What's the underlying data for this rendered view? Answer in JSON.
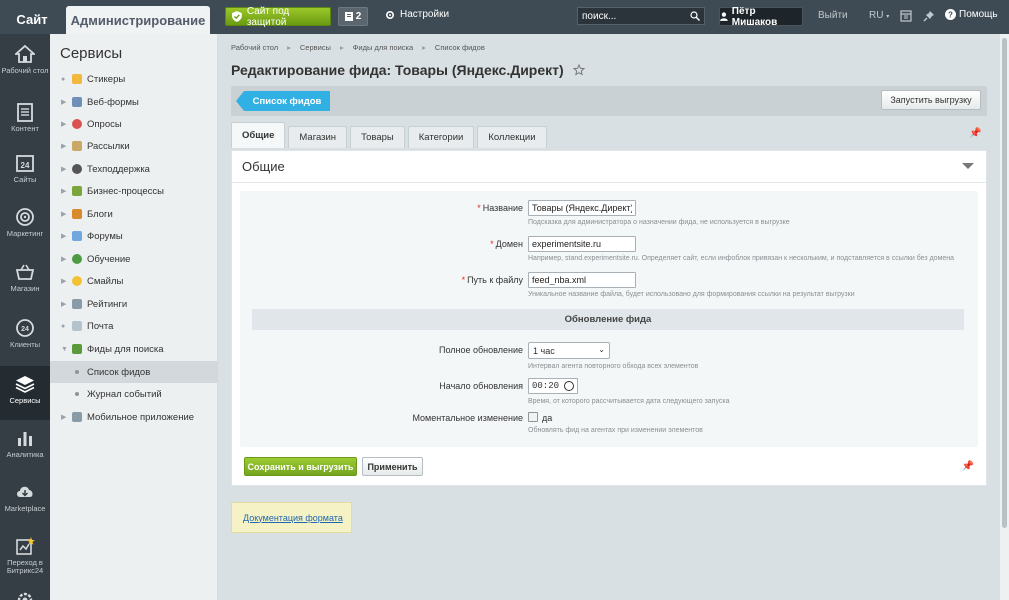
{
  "topbar": {
    "site_tab": "Сайт",
    "admin_tab": "Администрирование",
    "protect_button": "Сайт под защитой",
    "notify_count": "2",
    "settings": "Настройки",
    "search_placeholder": "поиск...",
    "user_name": "Пётр Мишаков",
    "logout": "Выйти",
    "lang": "RU",
    "help": "Помощь"
  },
  "iconbar": {
    "items": [
      {
        "label": "Рабочий стол",
        "icon": "home-icon"
      },
      {
        "label": "Контент",
        "icon": "document-icon"
      },
      {
        "label": "Сайты",
        "icon": "calendar-24-icon"
      },
      {
        "label": "Маркетинг",
        "icon": "target-icon"
      },
      {
        "label": "Магазин",
        "icon": "basket-icon"
      },
      {
        "label": "Клиенты",
        "icon": "clients-24-icon"
      },
      {
        "label": "Сервисы",
        "icon": "layers-icon"
      },
      {
        "label": "Аналитика",
        "icon": "bar-chart-icon"
      },
      {
        "label": "Marketplace",
        "icon": "cloud-download-icon"
      },
      {
        "label": "Переход в Битрикс24",
        "icon": "bitrix24-icon"
      }
    ]
  },
  "menu": {
    "title": "Сервисы",
    "items": [
      {
        "label": "Стикеры",
        "color": "#f0b93d"
      },
      {
        "label": "Веб-формы",
        "color": "#6f8fb8"
      },
      {
        "label": "Опросы",
        "color": "#d9534f"
      },
      {
        "label": "Рассылки",
        "color": "#c9a868"
      },
      {
        "label": "Техподдержка",
        "color": "#555555"
      },
      {
        "label": "Бизнес-процессы",
        "color": "#7aa53a"
      },
      {
        "label": "Блоги",
        "color": "#d98a2b"
      },
      {
        "label": "Форумы",
        "color": "#6fa8dc"
      },
      {
        "label": "Обучение",
        "color": "#4f9a45"
      },
      {
        "label": "Смайлы",
        "color": "#f2c230"
      },
      {
        "label": "Рейтинги",
        "color": "#8a9ba8"
      },
      {
        "label": "Почта",
        "color": "#b4c4cf"
      },
      {
        "label": "Фиды для поиска",
        "color": "#5b9a3b"
      }
    ],
    "sub_items": [
      {
        "label": "Список фидов"
      },
      {
        "label": "Журнал событий"
      }
    ],
    "last_item": {
      "label": "Мобильное приложение",
      "color": "#8a9ba8"
    }
  },
  "breadcrumb": [
    "Рабочий стол",
    "Сервисы",
    "Фиды для поиска",
    "Список фидов"
  ],
  "page_title": "Редактирование фида: Товары (Яндекс.Директ)",
  "actions": {
    "list_button": "Список фидов",
    "run_button": "Запустить выгрузку"
  },
  "tabs": [
    "Общие",
    "Магазин",
    "Товары",
    "Категории",
    "Коллекции"
  ],
  "panel": {
    "title": "Общие",
    "fields": {
      "name_label": "Название",
      "name_value": "Товары (Яндекс.Директ)",
      "name_hint": "Подсказка для администратора о назначении фида, не используется в выгрузке",
      "domain_label": "Домен",
      "domain_value": "experimentsite.ru",
      "domain_hint": "Например, stand.experimentsite.ru. Определяет сайт, если инфоблок привязан к нескольким, и подставляется в ссылки без домена",
      "path_label": "Путь к файлу",
      "path_value": "feed_nba.xml",
      "path_hint": "Уникальное название файла, будет использовано для формирования ссылки на результат выгрузки"
    },
    "section": "Обновление фида",
    "update": {
      "full_label": "Полное обновление",
      "full_value": "1 час",
      "full_hint": "Интервал агента повторного обхода всех элементов",
      "start_label": "Начало обновления",
      "start_value": "00:20",
      "start_hint": "Время, от которого рассчитывается дата следующего запуска",
      "instant_label": "Моментальное изменение",
      "instant_option": "да",
      "instant_hint": "Обновлять фид на агентах при изменении элементов"
    },
    "save_button": "Сохранить и выгрузить",
    "apply_button": "Применить"
  },
  "doc_link": "Документация формата"
}
